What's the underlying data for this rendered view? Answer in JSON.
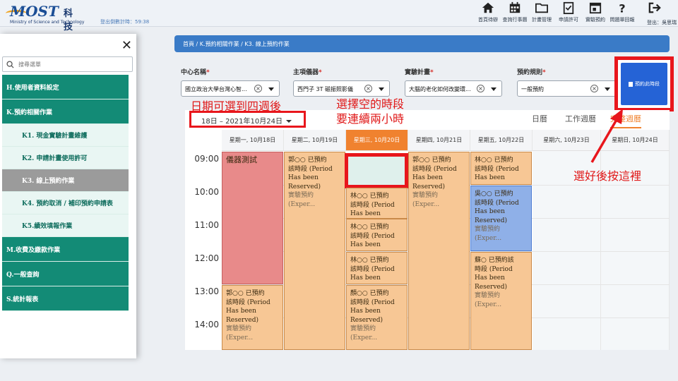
{
  "header": {
    "logo_main": "MOST",
    "logo_cn": "科技部",
    "logo_sub": "Ministry of Science and Technology",
    "countdown": "登出倒數計時：59:38",
    "icons": [
      {
        "name": "home-icon",
        "label": "首頁待辦"
      },
      {
        "name": "calendar-icon",
        "label": "查詢行事曆"
      },
      {
        "name": "folder-icon",
        "label": "計畫管理"
      },
      {
        "name": "permit-icon",
        "label": "申請許可"
      },
      {
        "name": "booking-icon",
        "label": "實驗預約"
      },
      {
        "name": "question-icon",
        "label": "問題單回報"
      }
    ],
    "logout": "登出：吳思瑞"
  },
  "sidebar": {
    "search_placeholder": "搜尋選單",
    "items": [
      {
        "label": "H.使用者資料設定",
        "type": "sec"
      },
      {
        "label": "K.預約相關作業",
        "type": "sec"
      },
      {
        "label": "K1. 現金實驗計畫維護",
        "type": "sub"
      },
      {
        "label": "K2. 申請計畫使用許可",
        "type": "sub"
      },
      {
        "label": "K3. 線上預約作業",
        "type": "sub",
        "active": true
      },
      {
        "label": "K4. 預約取消 / 補印預約申請表",
        "type": "sub"
      },
      {
        "label": "K5.績效填報作業",
        "type": "sub"
      },
      {
        "label": "M.收費及繳款作業",
        "type": "sec"
      },
      {
        "label": "Q.一般查詢",
        "type": "sec"
      },
      {
        "label": "S.統計報表",
        "type": "sec"
      }
    ]
  },
  "breadcrumb": "首頁 / K.預約相關作業 / K3. 線上預約作業",
  "filters": {
    "center_label": "中心名稱",
    "center_value": "國立政治大學台灣心智...",
    "instrument_label": "主項儀器",
    "instrument_value": "西門子 3T 磁振照影儀",
    "plan_label": "實驗計畫",
    "plan_value": "大腦的老化如何改變環...",
    "rule_label": "預約規則",
    "rule_value": "一般預約",
    "req_mark": "*"
  },
  "book_button": "預約此時段",
  "annotations": {
    "date_note": "日期可選到四週後",
    "select_note_1": "選擇空的時段",
    "select_note_2": "要連續兩小時",
    "press_note": "選好後按這裡"
  },
  "date_range": "18日 – 2021年10月24日",
  "view_tabs": {
    "day": "日曆",
    "workweek": "工作週曆",
    "week": "完整週曆"
  },
  "days": [
    "星期一, 10月18日",
    "星期二, 10月19日",
    "星期三, 10月20日",
    "星期四, 10月21日",
    "星期五, 10月22日",
    "星期六, 10月23日",
    "星期日, 10月24日"
  ],
  "times": [
    "09:00",
    "10:00",
    "11:00",
    "12:00",
    "13:00",
    "14:00"
  ],
  "events": {
    "mon_test": "儀器測試",
    "mon_13": {
      "l1": "郭○○ 已預約",
      "l2": "該時段 (Period",
      "l3": "Has been",
      "l4": "Reserved)",
      "l5": "實驗預約",
      "l6": "(Exper..."
    },
    "tue_9": {
      "l1": "郭○○ 已預約",
      "l2": "該時段 (Period",
      "l3": "Has been",
      "l4": "Reserved)",
      "l5": "實驗預約",
      "l6": "(Exper..."
    },
    "wed_10": {
      "l1": "林○○ 已預約",
      "l2": "該時段 (Period",
      "l3": "Has been"
    },
    "wed_11": {
      "l1": "林○○ 已預約",
      "l2": "該時段 (Period",
      "l3": "Has been"
    },
    "wed_12": {
      "l1": "林○○ 已預約",
      "l2": "該時段 (Period",
      "l3": "Has been"
    },
    "wed_13": {
      "l1": "顏○○ 已預約",
      "l2": "該時段 (Period",
      "l3": "Has been",
      "l4": "Reserved)",
      "l5": "實驗預約",
      "l6": "(Exper..."
    },
    "thu_9": {
      "l1": "郭○○ 已預約",
      "l2": "該時段 (Period",
      "l3": "Has been",
      "l4": "Reserved)",
      "l5": "實驗預約",
      "l6": "(Exper..."
    },
    "fri_9": {
      "l1": "林○○ 已預約",
      "l2": "該時段 (Period",
      "l3": "Has been"
    },
    "fri_10": {
      "l1": "吳○○ 已預約",
      "l2": "該時段 (Period",
      "l3": "Has been",
      "l4": "Reserved)",
      "l5": "實驗預約",
      "l6": "(Exper..."
    },
    "fri_12": {
      "l1": "蘇○ 已預約該",
      "l2": "時段 (Period",
      "l3": "Has been",
      "l4": "Reserved)",
      "l5": "實驗預約",
      "l6": "(Exper..."
    }
  },
  "colors": {
    "accent": "#f0822f",
    "menu_green": "#138b76",
    "annotation_red": "#e8161c",
    "primary_blue": "#2563d6"
  }
}
